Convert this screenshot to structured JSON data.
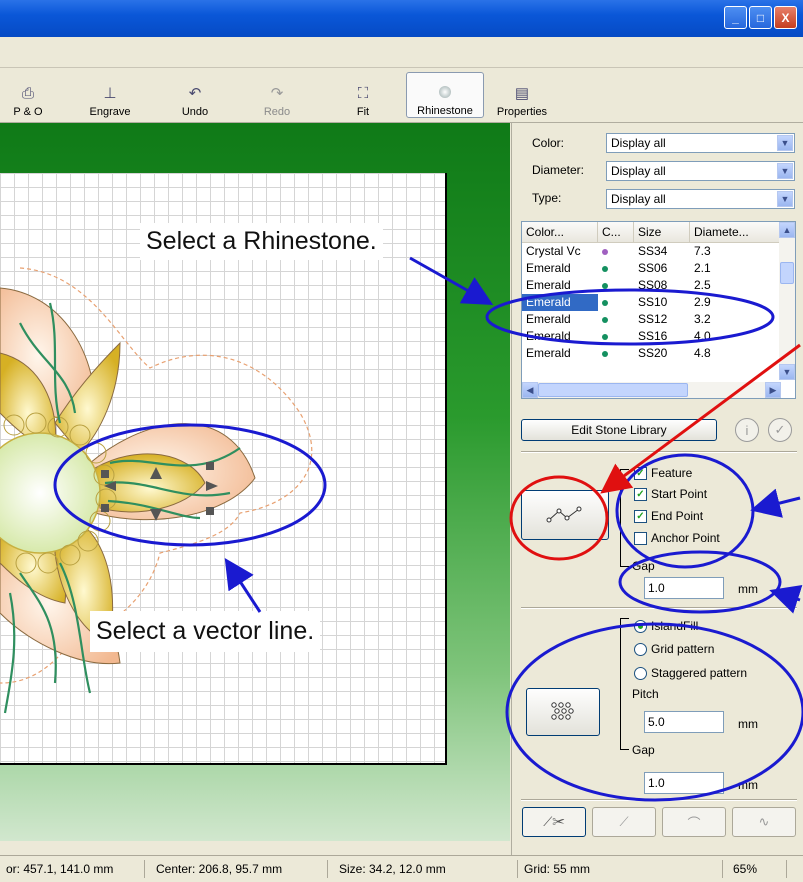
{
  "window": {
    "min": "_",
    "max": "□",
    "close": "X"
  },
  "toolbar": {
    "buttons": [
      {
        "label": "P & O",
        "icon": "p-and-o-icon"
      },
      {
        "label": "Engrave",
        "icon": "engrave-icon"
      },
      {
        "label": "Undo",
        "icon": "undo-icon"
      },
      {
        "label": "Redo",
        "icon": "redo-icon"
      },
      {
        "label": "Fit",
        "icon": "fit-icon"
      },
      {
        "label": "Rhinestone",
        "icon": "rhinestone-icon"
      },
      {
        "label": "Properties",
        "icon": "properties-icon"
      }
    ]
  },
  "annotations": {
    "select_rhinestone": "Select a Rhinestone.",
    "select_vector": "Select a vector line."
  },
  "filters": {
    "color_label": "Color:",
    "color_value": "Display all",
    "diameter_label": "Diameter:",
    "diameter_value": "Display all",
    "type_label": "Type:",
    "type_value": "Display all"
  },
  "stone_list": {
    "headers": [
      "Color...",
      "C...",
      "Size",
      "Diamete..."
    ],
    "rows": [
      {
        "color": "Crystal Vc",
        "dot": "#a060c0",
        "size": "SS34",
        "diameter": "7.3",
        "selected": false
      },
      {
        "color": "Emerald",
        "dot": "#149060",
        "size": "SS06",
        "diameter": "2.1",
        "selected": false
      },
      {
        "color": "Emerald",
        "dot": "#149060",
        "size": "SS08",
        "diameter": "2.5",
        "selected": false
      },
      {
        "color": "Emerald",
        "dot": "#149060",
        "size": "SS10",
        "diameter": "2.9",
        "selected": true
      },
      {
        "color": "Emerald",
        "dot": "#149060",
        "size": "SS12",
        "diameter": "3.2",
        "selected": false
      },
      {
        "color": "Emerald",
        "dot": "#149060",
        "size": "SS16",
        "diameter": "4.0",
        "selected": false
      },
      {
        "color": "Emerald",
        "dot": "#149060",
        "size": "SS20",
        "diameter": "4.8",
        "selected": false
      }
    ]
  },
  "edit_stone_library": "Edit Stone Library",
  "line_section": {
    "feature": "Feature",
    "start_point": "Start Point",
    "end_point": "End Point",
    "anchor_point": "Anchor Point",
    "gap_label": "Gap",
    "gap_value": "1.0",
    "unit": "mm"
  },
  "fill_section": {
    "island_fill": "IslandFill",
    "grid_pattern": "Grid pattern",
    "staggered_pattern": "Staggered pattern",
    "pitch_label": "Pitch",
    "pitch_value": "5.0",
    "gap_label": "Gap",
    "gap_value": "1.0",
    "unit": "mm",
    "unit2": "mm"
  },
  "status": {
    "cursor": "or: 457.1, 141.0 mm",
    "center": "Center: 206.8, 95.7 mm",
    "size": "Size: 34.2, 12.0 mm",
    "grid": "Grid: 55 mm",
    "zoom": "65%"
  }
}
